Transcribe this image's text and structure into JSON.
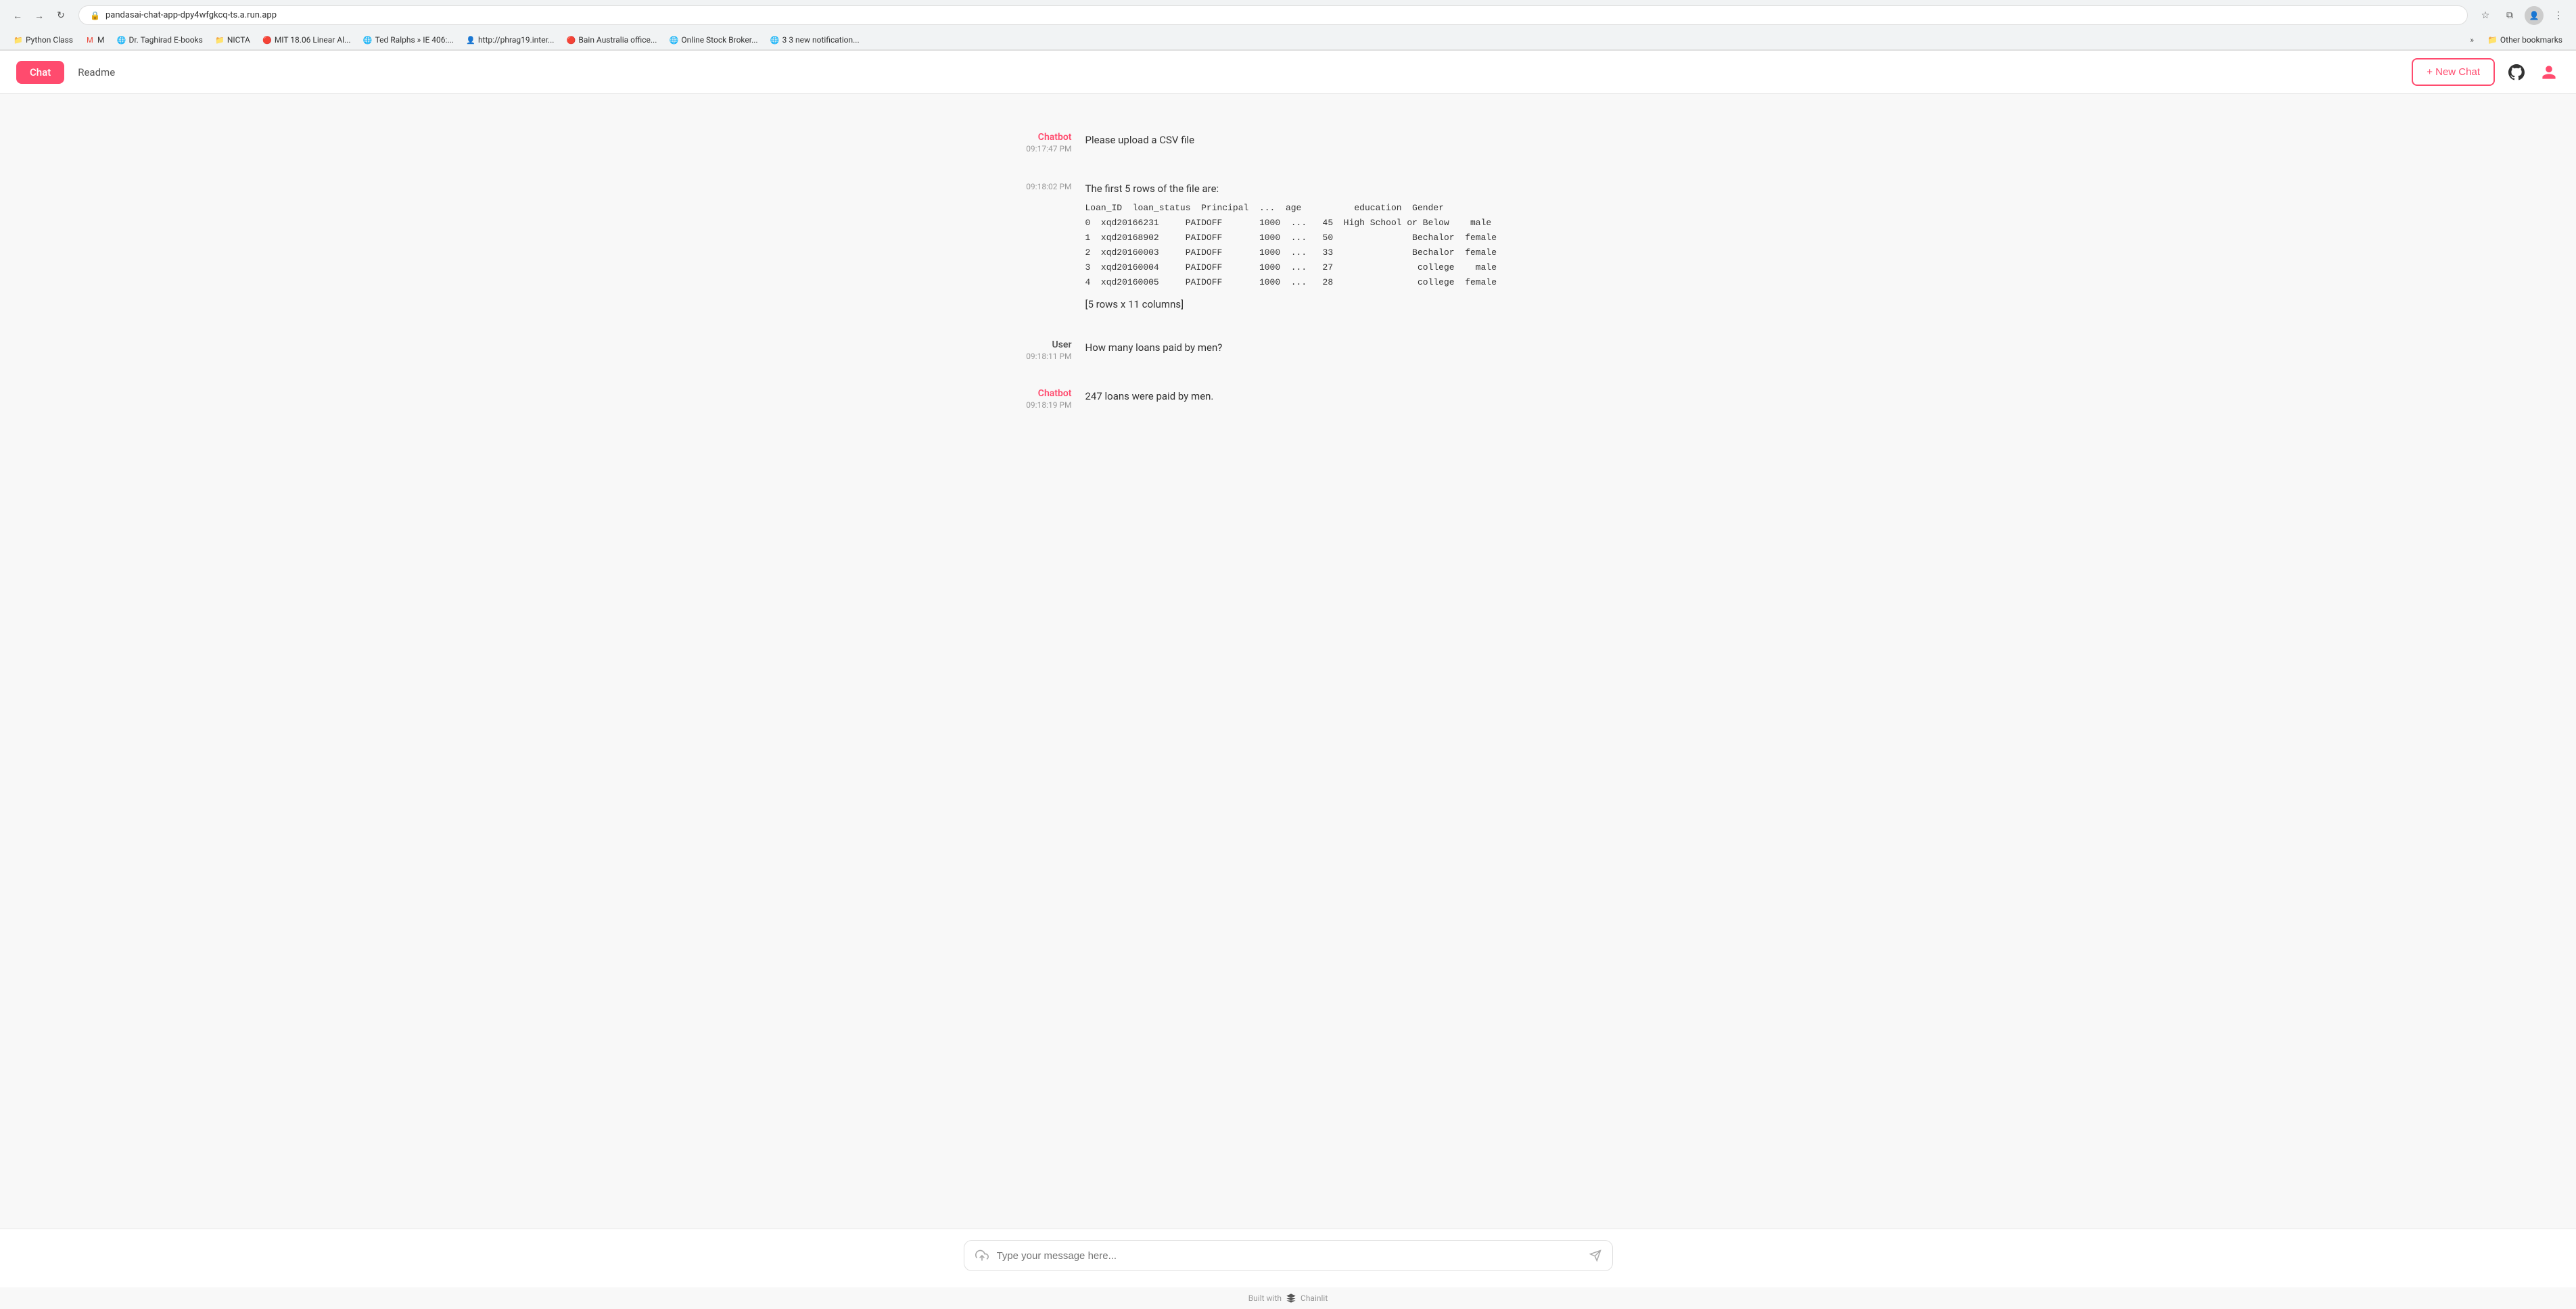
{
  "browser": {
    "url": "pandasai-chat-app-dpy4wfgkcq-ts.a.run.app",
    "nav": {
      "back": "←",
      "forward": "→",
      "reload": "↻"
    },
    "bookmarks": [
      {
        "id": "python-class",
        "label": "Python Class",
        "icon": "📁",
        "color": "#f4c542"
      },
      {
        "id": "gmail",
        "label": "M",
        "icon": "M",
        "color": "#ea4335"
      },
      {
        "id": "taghirad",
        "label": "Dr. Taghirad E-books",
        "icon": "🌐"
      },
      {
        "id": "nicta",
        "label": "NICTA",
        "icon": "📁",
        "color": "#f4c542"
      },
      {
        "id": "mit",
        "label": "MIT 18.06 Linear Al...",
        "icon": "🔴"
      },
      {
        "id": "ted-ralphs",
        "label": "Ted Ralphs » IE 406:...",
        "icon": "🌐"
      },
      {
        "id": "phrag",
        "label": "http://phrag19.inter...",
        "icon": "👤"
      },
      {
        "id": "bain",
        "label": "Bain Australia office...",
        "icon": "🔴"
      },
      {
        "id": "online-stock",
        "label": "Online Stock Broker...",
        "icon": "🌐"
      },
      {
        "id": "notifications",
        "label": "3 3 new notification...",
        "icon": "🌐"
      }
    ],
    "other_bookmarks_label": "Other bookmarks"
  },
  "header": {
    "tabs": [
      {
        "id": "chat",
        "label": "Chat",
        "active": true
      },
      {
        "id": "readme",
        "label": "Readme",
        "active": false
      }
    ],
    "new_chat_label": "+ New Chat",
    "github_label": "GitHub",
    "user_label": "User"
  },
  "messages": [
    {
      "id": "msg1",
      "sender": "Chatbot",
      "sender_type": "chatbot",
      "time": "09:17:47 PM",
      "content": "Please upload a CSV file",
      "has_table": false
    },
    {
      "id": "msg2",
      "sender": "",
      "sender_type": "chatbot",
      "time": "09:18:02 PM",
      "content": "The first 5 rows of the file are:",
      "has_table": true,
      "table_data": "Loan_ID  loan_status  Principal  ...  age          education  Gender\n0  xqd20166231     PAIDOFF       1000  ...   45  High School or Below    male\n1  xqd20168902     PAIDOFF       1000  ...   50               Bechalor  female\n2  xqd20160003     PAIDOFF       1000  ...   33               Bechalor  female\n3  xqd20160004     PAIDOFF       1000  ...   27                college    male\n4  xqd20160005     PAIDOFF       1000  ...   28                college  female",
      "footer": "[5 rows x 11 columns]"
    },
    {
      "id": "msg3",
      "sender": "User",
      "sender_type": "user",
      "time": "09:18:11 PM",
      "content": "How many loans paid by men?",
      "has_table": false
    },
    {
      "id": "msg4",
      "sender": "Chatbot",
      "sender_type": "chatbot",
      "time": "09:18:19 PM",
      "content": "247 loans were paid by men.",
      "has_table": false
    }
  ],
  "input": {
    "placeholder": "Type your message here...",
    "upload_label": "Upload",
    "send_label": "Send"
  },
  "footer": {
    "built_with": "Built with",
    "brand": "Chainlit"
  }
}
